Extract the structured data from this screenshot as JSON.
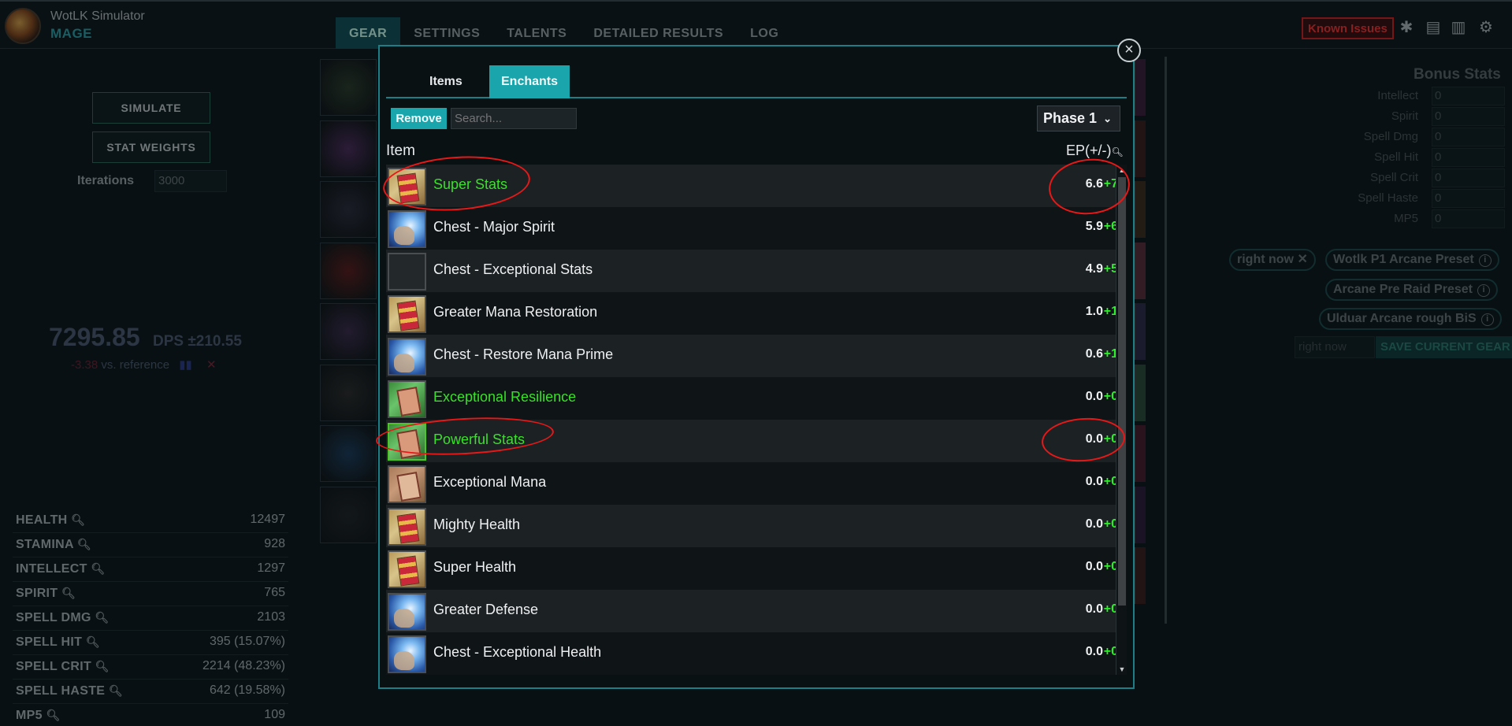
{
  "app": {
    "title": "WotLK Simulator",
    "subtitle": "MAGE"
  },
  "nav": {
    "tabs": [
      "GEAR",
      "SETTINGS",
      "TALENTS",
      "DETAILED RESULTS",
      "LOG"
    ],
    "active": "GEAR",
    "known_issues": "Known Issues",
    "icons": [
      "bug-icon",
      "import-icon",
      "export-icon",
      "gear-icon"
    ]
  },
  "sidebar": {
    "simulate": "SIMULATE",
    "stat_weights": "STAT WEIGHTS",
    "iterations_label": "Iterations",
    "iterations_value": "3000",
    "dps_value": "7295.85",
    "dps_unit": "DPS ±210.55",
    "ref_delta": "-3.38",
    "ref_text": "vs. reference",
    "ref_icon": "ref-badge-icon",
    "stats": [
      {
        "name": "HEALTH",
        "value": "12497"
      },
      {
        "name": "STAMINA",
        "value": "928"
      },
      {
        "name": "INTELLECT",
        "value": "1297"
      },
      {
        "name": "SPIRIT",
        "value": "765"
      },
      {
        "name": "SPELL DMG",
        "value": "2103"
      },
      {
        "name": "SPELL HIT",
        "value": "395 (15.07%)"
      },
      {
        "name": "SPELL CRIT",
        "value": "2214 (48.23%)"
      },
      {
        "name": "SPELL HASTE",
        "value": "642 (19.58%)"
      },
      {
        "name": "MP5",
        "value": "109"
      }
    ]
  },
  "bonus": {
    "title": "Bonus Stats",
    "rows": [
      {
        "label": "Intellect",
        "value": "0"
      },
      {
        "label": "Spirit",
        "value": "0"
      },
      {
        "label": "Spell Dmg",
        "value": "0"
      },
      {
        "label": "Spell Hit",
        "value": "0"
      },
      {
        "label": "Spell Crit",
        "value": "0"
      },
      {
        "label": "Spell Haste",
        "value": "0"
      },
      {
        "label": "MP5",
        "value": "0"
      }
    ]
  },
  "presets": {
    "right_now": "right now",
    "wotlk_p1": "Wotlk P1 Arcane Preset",
    "pre_raid": "Arcane Pre Raid Preset",
    "ulduar": "Ulduar Arcane rough BiS",
    "name_input": "right now",
    "save": "SAVE CURRENT GEAR"
  },
  "modal": {
    "tabs": [
      "Items",
      "Enchants"
    ],
    "active_tab": "Enchants",
    "remove": "Remove",
    "search_placeholder": "Search...",
    "phase": "Phase 1",
    "col_item": "Item",
    "col_ep": "EP(+/-)",
    "rows": [
      {
        "name": "Super Stats",
        "ep": "6.6",
        "diff": "+7",
        "icon": "scroll-icon",
        "green": true,
        "selected": false
      },
      {
        "name": "Chest - Major Spirit",
        "ep": "5.9",
        "diff": "+6",
        "icon": "spell-hand-icon",
        "green": false,
        "selected": false
      },
      {
        "name": "Chest - Exceptional Stats",
        "ep": "4.9",
        "diff": "+5",
        "icon": "empty-icon",
        "green": false,
        "selected": false
      },
      {
        "name": "Greater Mana Restoration",
        "ep": "1.0",
        "diff": "+1",
        "icon": "scroll-icon",
        "green": false,
        "selected": false
      },
      {
        "name": "Chest - Restore Mana Prime",
        "ep": "0.6",
        "diff": "+1",
        "icon": "spell-hand-icon",
        "green": false,
        "selected": false
      },
      {
        "name": "Exceptional Resilience",
        "ep": "0.0",
        "diff": "+0",
        "icon": "green-scroll-icon",
        "green": true,
        "selected": false
      },
      {
        "name": "Powerful Stats",
        "ep": "0.0",
        "diff": "+0",
        "icon": "green-scroll-icon",
        "green": true,
        "selected": true
      },
      {
        "name": "Exceptional Mana",
        "ep": "0.0",
        "diff": "+0",
        "icon": "tan-scroll-icon",
        "green": false,
        "selected": false
      },
      {
        "name": "Mighty Health",
        "ep": "0.0",
        "diff": "+0",
        "icon": "scroll-icon",
        "green": false,
        "selected": false
      },
      {
        "name": "Super Health",
        "ep": "0.0",
        "diff": "+0",
        "icon": "scroll-icon",
        "green": false,
        "selected": false
      },
      {
        "name": "Greater Defense",
        "ep": "0.0",
        "diff": "+0",
        "icon": "spell-hand-icon",
        "green": false,
        "selected": false
      },
      {
        "name": "Chest - Exceptional Health",
        "ep": "0.0",
        "diff": "+0",
        "icon": "spell-hand-icon",
        "green": false,
        "selected": false
      }
    ]
  },
  "colors": {
    "accent": "#1aa5ac",
    "highlight_green": "#3ae02a",
    "annotation_red": "#e81818"
  }
}
